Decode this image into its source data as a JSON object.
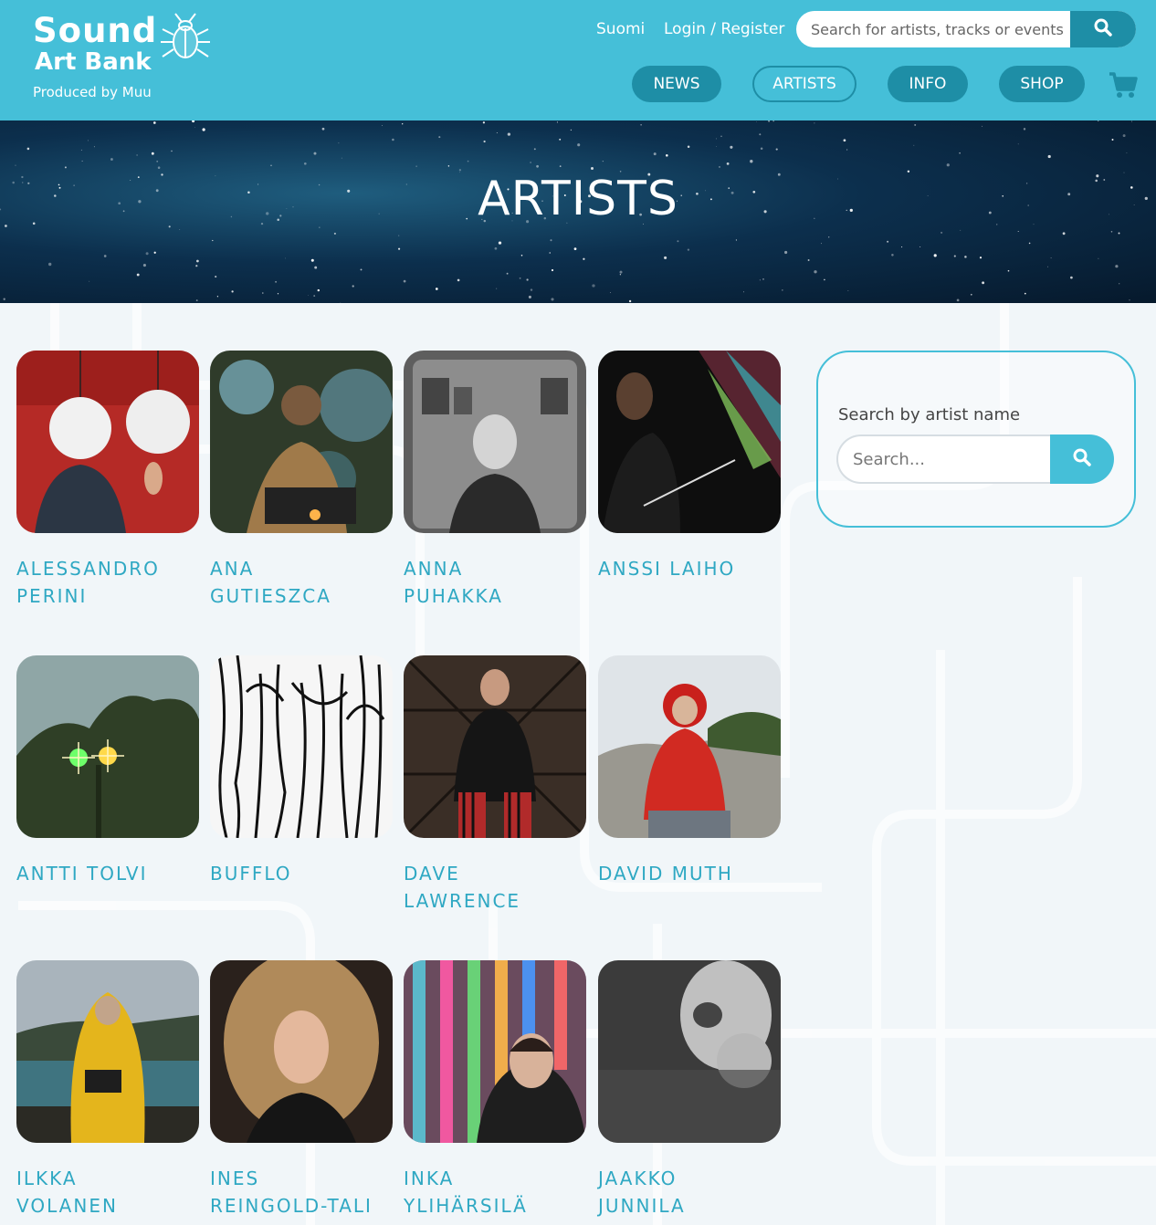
{
  "brand": {
    "line1": "Sound",
    "line2": "Art Bank",
    "tagline": "Produced by Muu",
    "logo_icon": "beetle-icon"
  },
  "header": {
    "language_link": "Suomi",
    "login_link": "Login / Register",
    "search_placeholder": "Search for artists, tracks or events",
    "search_icon": "search-icon",
    "nav": [
      "NEWS",
      "ARTISTS",
      "INFO",
      "SHOP"
    ],
    "active_nav": "ARTISTS",
    "cart_icon": "cart-icon"
  },
  "hero": {
    "title": "ARTISTS"
  },
  "artists": [
    {
      "name": "ALESSANDRO PERINI"
    },
    {
      "name": "ANA GUTIESZCA"
    },
    {
      "name": "ANNA PUHAKKA"
    },
    {
      "name": "ANSSI LAIHO"
    },
    {
      "name": "ANTTI TOLVI"
    },
    {
      "name": "BUFFLO"
    },
    {
      "name": "DAVE LAWRENCE"
    },
    {
      "name": "DAVID MUTH"
    },
    {
      "name": "ILKKA VOLANEN"
    },
    {
      "name": "INES REINGOLD-TALI"
    },
    {
      "name": "INKA YLIHÄRSILÄ"
    },
    {
      "name": "JAAKKO JUNNILA"
    }
  ],
  "sidebar": {
    "label": "Search by artist name",
    "placeholder": "Search...",
    "search_icon": "search-icon"
  },
  "colors": {
    "brand": "#45bfd8",
    "brand_dark": "#1e8ea6",
    "artist_name": "#2fa8c3"
  }
}
